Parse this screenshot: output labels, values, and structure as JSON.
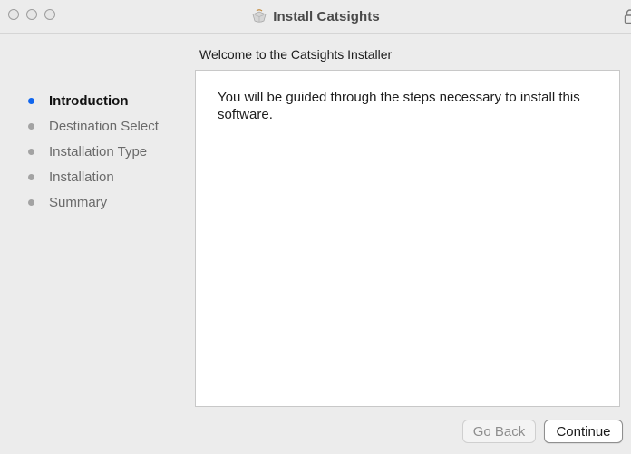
{
  "window": {
    "title": "Install Catsights",
    "title_icon": "installer-package-icon",
    "lock_icon": "lock-icon"
  },
  "content": {
    "heading": "Welcome to the Catsights Installer",
    "body": "You will be guided through the steps necessary to install this software."
  },
  "steps": [
    {
      "label": "Introduction",
      "active": true
    },
    {
      "label": "Destination Select",
      "active": false
    },
    {
      "label": "Installation Type",
      "active": false
    },
    {
      "label": "Installation",
      "active": false
    },
    {
      "label": "Summary",
      "active": false
    }
  ],
  "buttons": {
    "go_back": "Go Back",
    "continue": "Continue"
  },
  "colors": {
    "active_step_bullet": "#1166ee",
    "inactive_step_bullet": "#a3a3a3",
    "window_background": "#ececec"
  }
}
